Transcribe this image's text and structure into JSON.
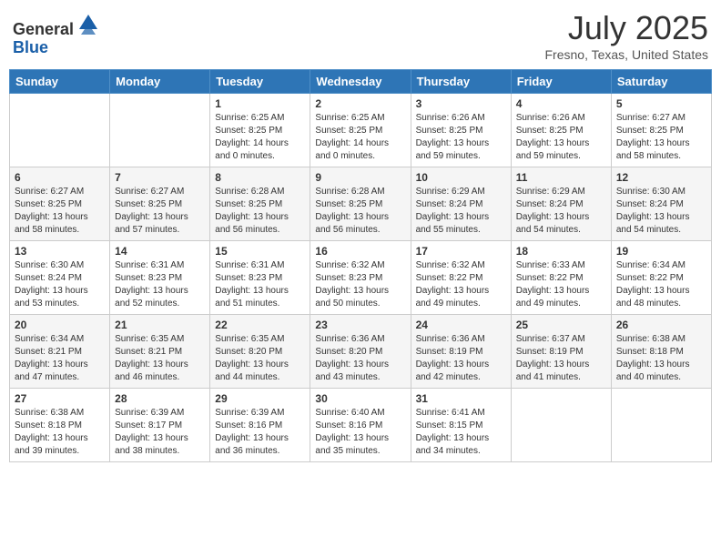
{
  "header": {
    "logo": {
      "line1": "General",
      "line2": "Blue"
    },
    "title": "July 2025",
    "location": "Fresno, Texas, United States"
  },
  "days_of_week": [
    "Sunday",
    "Monday",
    "Tuesday",
    "Wednesday",
    "Thursday",
    "Friday",
    "Saturday"
  ],
  "weeks": [
    [
      {
        "day": "",
        "info": ""
      },
      {
        "day": "",
        "info": ""
      },
      {
        "day": "1",
        "info": "Sunrise: 6:25 AM\nSunset: 8:25 PM\nDaylight: 14 hours and 0 minutes."
      },
      {
        "day": "2",
        "info": "Sunrise: 6:25 AM\nSunset: 8:25 PM\nDaylight: 14 hours and 0 minutes."
      },
      {
        "day": "3",
        "info": "Sunrise: 6:26 AM\nSunset: 8:25 PM\nDaylight: 13 hours and 59 minutes."
      },
      {
        "day": "4",
        "info": "Sunrise: 6:26 AM\nSunset: 8:25 PM\nDaylight: 13 hours and 59 minutes."
      },
      {
        "day": "5",
        "info": "Sunrise: 6:27 AM\nSunset: 8:25 PM\nDaylight: 13 hours and 58 minutes."
      }
    ],
    [
      {
        "day": "6",
        "info": "Sunrise: 6:27 AM\nSunset: 8:25 PM\nDaylight: 13 hours and 58 minutes."
      },
      {
        "day": "7",
        "info": "Sunrise: 6:27 AM\nSunset: 8:25 PM\nDaylight: 13 hours and 57 minutes."
      },
      {
        "day": "8",
        "info": "Sunrise: 6:28 AM\nSunset: 8:25 PM\nDaylight: 13 hours and 56 minutes."
      },
      {
        "day": "9",
        "info": "Sunrise: 6:28 AM\nSunset: 8:25 PM\nDaylight: 13 hours and 56 minutes."
      },
      {
        "day": "10",
        "info": "Sunrise: 6:29 AM\nSunset: 8:24 PM\nDaylight: 13 hours and 55 minutes."
      },
      {
        "day": "11",
        "info": "Sunrise: 6:29 AM\nSunset: 8:24 PM\nDaylight: 13 hours and 54 minutes."
      },
      {
        "day": "12",
        "info": "Sunrise: 6:30 AM\nSunset: 8:24 PM\nDaylight: 13 hours and 54 minutes."
      }
    ],
    [
      {
        "day": "13",
        "info": "Sunrise: 6:30 AM\nSunset: 8:24 PM\nDaylight: 13 hours and 53 minutes."
      },
      {
        "day": "14",
        "info": "Sunrise: 6:31 AM\nSunset: 8:23 PM\nDaylight: 13 hours and 52 minutes."
      },
      {
        "day": "15",
        "info": "Sunrise: 6:31 AM\nSunset: 8:23 PM\nDaylight: 13 hours and 51 minutes."
      },
      {
        "day": "16",
        "info": "Sunrise: 6:32 AM\nSunset: 8:23 PM\nDaylight: 13 hours and 50 minutes."
      },
      {
        "day": "17",
        "info": "Sunrise: 6:32 AM\nSunset: 8:22 PM\nDaylight: 13 hours and 49 minutes."
      },
      {
        "day": "18",
        "info": "Sunrise: 6:33 AM\nSunset: 8:22 PM\nDaylight: 13 hours and 49 minutes."
      },
      {
        "day": "19",
        "info": "Sunrise: 6:34 AM\nSunset: 8:22 PM\nDaylight: 13 hours and 48 minutes."
      }
    ],
    [
      {
        "day": "20",
        "info": "Sunrise: 6:34 AM\nSunset: 8:21 PM\nDaylight: 13 hours and 47 minutes."
      },
      {
        "day": "21",
        "info": "Sunrise: 6:35 AM\nSunset: 8:21 PM\nDaylight: 13 hours and 46 minutes."
      },
      {
        "day": "22",
        "info": "Sunrise: 6:35 AM\nSunset: 8:20 PM\nDaylight: 13 hours and 44 minutes."
      },
      {
        "day": "23",
        "info": "Sunrise: 6:36 AM\nSunset: 8:20 PM\nDaylight: 13 hours and 43 minutes."
      },
      {
        "day": "24",
        "info": "Sunrise: 6:36 AM\nSunset: 8:19 PM\nDaylight: 13 hours and 42 minutes."
      },
      {
        "day": "25",
        "info": "Sunrise: 6:37 AM\nSunset: 8:19 PM\nDaylight: 13 hours and 41 minutes."
      },
      {
        "day": "26",
        "info": "Sunrise: 6:38 AM\nSunset: 8:18 PM\nDaylight: 13 hours and 40 minutes."
      }
    ],
    [
      {
        "day": "27",
        "info": "Sunrise: 6:38 AM\nSunset: 8:18 PM\nDaylight: 13 hours and 39 minutes."
      },
      {
        "day": "28",
        "info": "Sunrise: 6:39 AM\nSunset: 8:17 PM\nDaylight: 13 hours and 38 minutes."
      },
      {
        "day": "29",
        "info": "Sunrise: 6:39 AM\nSunset: 8:16 PM\nDaylight: 13 hours and 36 minutes."
      },
      {
        "day": "30",
        "info": "Sunrise: 6:40 AM\nSunset: 8:16 PM\nDaylight: 13 hours and 35 minutes."
      },
      {
        "day": "31",
        "info": "Sunrise: 6:41 AM\nSunset: 8:15 PM\nDaylight: 13 hours and 34 minutes."
      },
      {
        "day": "",
        "info": ""
      },
      {
        "day": "",
        "info": ""
      }
    ]
  ]
}
